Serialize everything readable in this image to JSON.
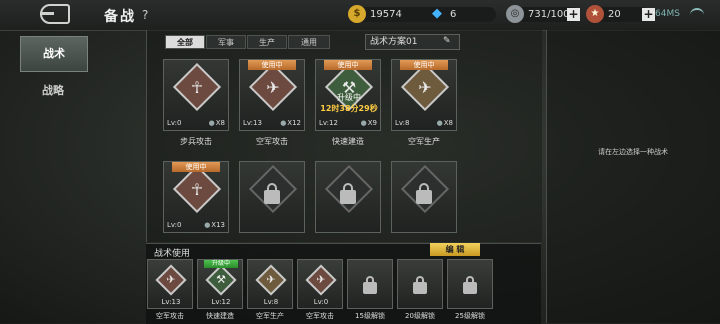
{
  "header": {
    "title": "备战",
    "help": "?",
    "gold": "19574",
    "diamond": "6",
    "silver": "731/100",
    "medal": "20",
    "ping": "64MS"
  },
  "sidebar": {
    "tabs": [
      {
        "label": "战术",
        "active": true
      },
      {
        "label": "战略",
        "active": false
      }
    ]
  },
  "filters": {
    "tabs": [
      "全部",
      "军事",
      "生产",
      "通用"
    ],
    "plan": "战术方案01"
  },
  "cards": [
    {
      "name": "步兵攻击",
      "level": "Lv:0",
      "count": "X8",
      "badge": "",
      "icon": "infantry",
      "color": "red"
    },
    {
      "name": "空军攻击",
      "level": "Lv:13",
      "count": "X12",
      "badge": "使用中",
      "icon": "jet",
      "color": "red"
    },
    {
      "name": "快速建造",
      "level": "Lv:12",
      "count": "X9",
      "badge": "使用中",
      "icon": "crane",
      "color": "green",
      "upgrade_label": "升级中",
      "upgrade_timer": "12时38分29秒"
    },
    {
      "name": "空军生产",
      "level": "Lv:8",
      "count": "X8",
      "badge": "使用中",
      "icon": "jet",
      "color": "tan"
    },
    {
      "name": "",
      "level": "Lv:0",
      "count": "X13",
      "badge": "使用中",
      "icon": "infantry",
      "color": "red"
    },
    {
      "name": "",
      "level": "",
      "count": "",
      "badge": "",
      "icon": "lock",
      "color": "dark"
    },
    {
      "name": "",
      "level": "",
      "count": "",
      "badge": "",
      "icon": "lock",
      "color": "dark"
    },
    {
      "name": "",
      "level": "",
      "count": "",
      "badge": "",
      "icon": "lock",
      "color": "dark"
    }
  ],
  "hint": "请在左边选择一种战术",
  "usage": {
    "title": "战术使用",
    "edit": "编 辑",
    "slots": [
      {
        "name": "空军攻击",
        "level": "Lv:13",
        "badge": "",
        "color": "red"
      },
      {
        "name": "快速建造",
        "level": "Lv:12",
        "badge": "升级中",
        "color": "green"
      },
      {
        "name": "空军生产",
        "level": "Lv:8",
        "badge": "",
        "color": "tan"
      },
      {
        "name": "空军攻击",
        "level": "Lv:0",
        "badge": "",
        "color": "red"
      },
      {
        "name": "15级解锁",
        "level": "",
        "badge": "",
        "color": "lock"
      },
      {
        "name": "20级解锁",
        "level": "",
        "badge": "",
        "color": "lock"
      },
      {
        "name": "25级解锁",
        "level": "",
        "badge": "",
        "color": "lock"
      }
    ]
  }
}
